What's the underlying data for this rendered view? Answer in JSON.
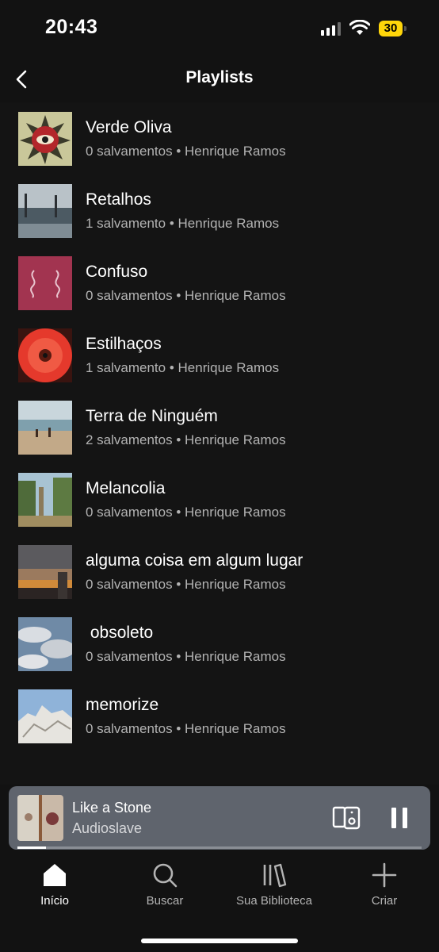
{
  "status_bar": {
    "time": "20:43",
    "battery": "30",
    "battery_color": "#ffd60a",
    "icons": [
      "cellular-signal-icon",
      "wifi-icon",
      "battery-icon"
    ]
  },
  "header": {
    "title": "Playlists",
    "back_icon": "chevron-left-icon"
  },
  "playlists": [
    {
      "title": "Verde Oliva",
      "subtitle": "0 salvamentos • Henrique Ramos"
    },
    {
      "title": "Retalhos",
      "subtitle": "1 salvamento • Henrique Ramos"
    },
    {
      "title": "Confuso",
      "subtitle": "0 salvamentos • Henrique Ramos"
    },
    {
      "title": "Estilhaços",
      "subtitle": "1 salvamento • Henrique Ramos"
    },
    {
      "title": "Terra de Ninguém",
      "subtitle": "2 salvamentos • Henrique Ramos"
    },
    {
      "title": "Melancolia",
      "subtitle": "0 salvamentos • Henrique Ramos"
    },
    {
      "title": "alguma coisa em algum lugar",
      "subtitle": "0 salvamentos • Henrique Ramos"
    },
    {
      "title": " obsoleto",
      "subtitle": "0 salvamentos • Henrique Ramos"
    },
    {
      "title": "memorize",
      "subtitle": "0 salvamentos • Henrique Ramos"
    }
  ],
  "now_playing": {
    "title": "Like a Stone",
    "artist": "Audioslave",
    "progress": 0.07,
    "background": "#5f646d",
    "icons": [
      "connect-device-icon",
      "pause-icon"
    ]
  },
  "tabs": [
    {
      "label": "Início",
      "icon": "home-icon",
      "active": true
    },
    {
      "label": "Buscar",
      "icon": "search-icon",
      "active": false
    },
    {
      "label": "Sua Biblioteca",
      "icon": "library-icon",
      "active": false
    },
    {
      "label": "Criar",
      "icon": "plus-icon",
      "active": false
    }
  ]
}
